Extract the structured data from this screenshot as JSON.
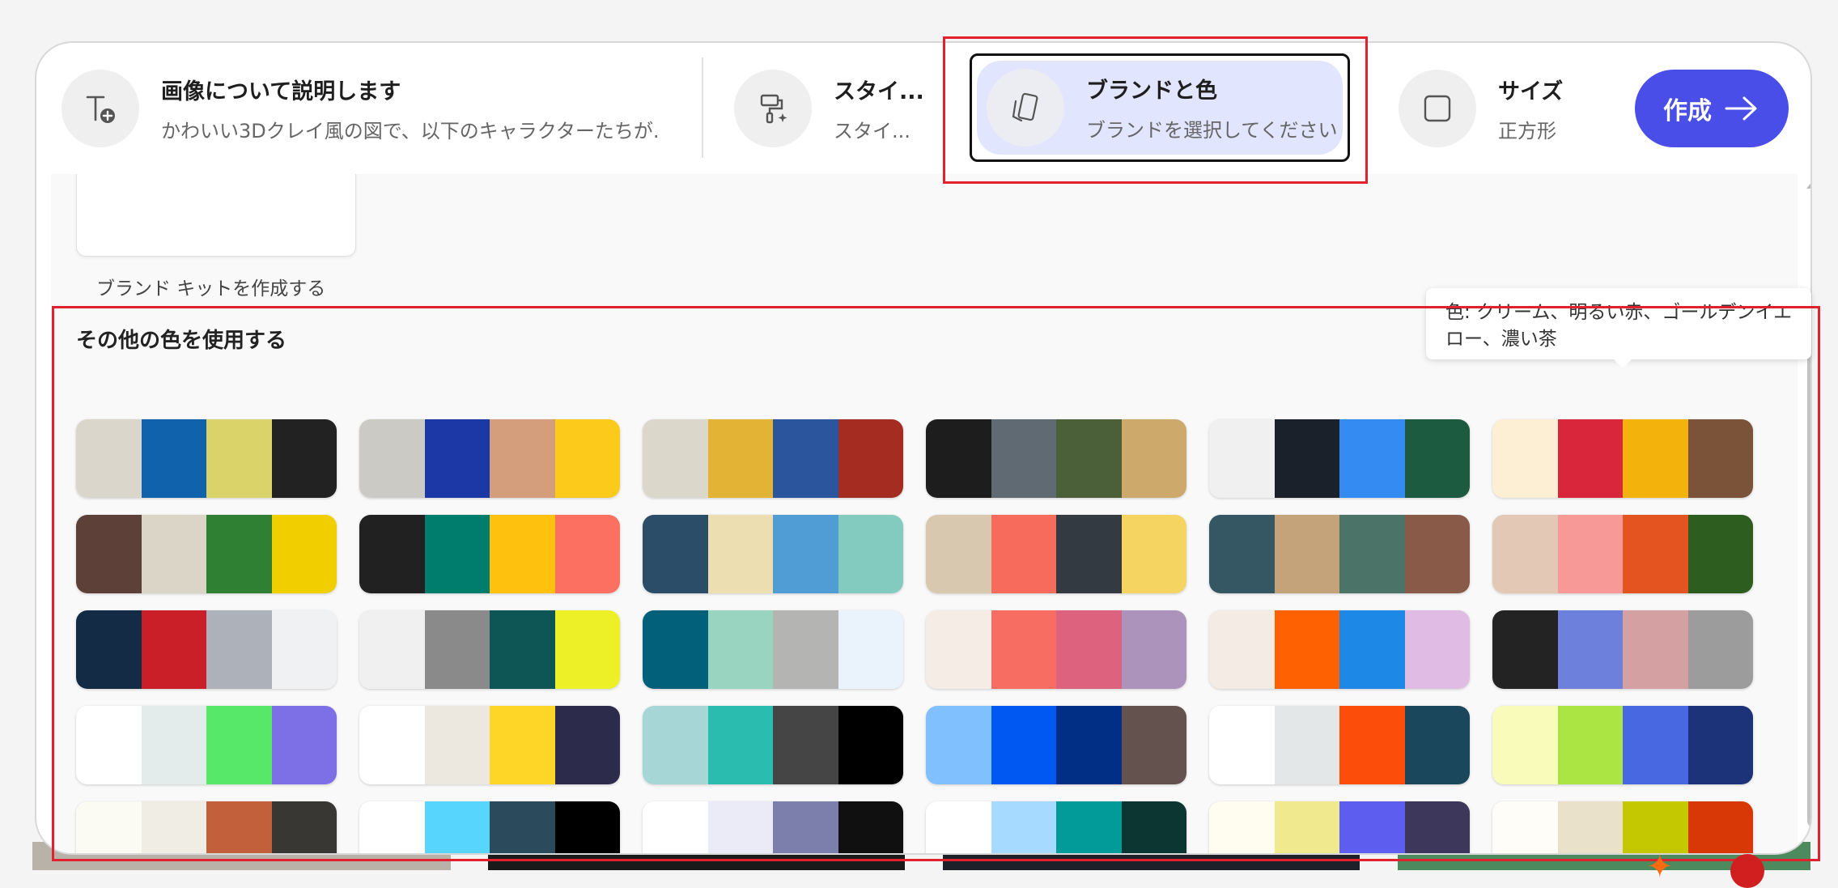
{
  "toolbar": {
    "describe": {
      "title": "画像について説明します",
      "subtitle": "かわいい3Dクレイ風の図で、以下のキャラクターたちが..."
    },
    "style": {
      "title": "スタイ...",
      "subtitle": "スタイ..."
    },
    "brand": {
      "title": "ブランドと色",
      "subtitle": "ブランドを選択してください"
    },
    "size": {
      "title": "サイズ",
      "subtitle": "正方形"
    },
    "create_label": "作成"
  },
  "brand_kit": {
    "create_label": "ブランド キットを作成する"
  },
  "other_colors": {
    "title": "その他の色を使用する"
  },
  "tooltip": {
    "text": "色: クリーム、明るい赤、ゴールデンイエロー、濃い茶"
  },
  "palettes": [
    [
      "#dbd6cb",
      "#0f62ab",
      "#dad36a",
      "#222222"
    ],
    [
      "#cbcac5",
      "#1c37a6",
      "#d49d7c",
      "#fcca1a"
    ],
    [
      "#dbd7cb",
      "#e2b334",
      "#2b569e",
      "#a52c20"
    ],
    [
      "#1d1d1d",
      "#606a72",
      "#4b5f39",
      "#cda96c"
    ],
    [
      "#f0f0f0",
      "#1a212b",
      "#348cf2",
      "#1c5b3f"
    ],
    [
      "#fdefd4",
      "#d9263a",
      "#f3b20c",
      "#7b5339"
    ],
    [
      "#5d4038",
      "#dbd5c8",
      "#2f8033",
      "#f0ce00"
    ],
    [
      "#212121",
      "#007d6d",
      "#fec10e",
      "#fc7062"
    ],
    [
      "#2c4d68",
      "#ecdeb0",
      "#4f9dd4",
      "#83cbbe"
    ],
    [
      "#d9c8b0",
      "#f76b5d",
      "#343a41",
      "#f6d462"
    ],
    [
      "#345763",
      "#c4a27a",
      "#4b7368",
      "#8a5a48"
    ],
    [
      "#e2c8b5",
      "#f79996",
      "#e35420",
      "#2e5e1f"
    ],
    [
      "#142b45",
      "#ca1e28",
      "#adb1b9",
      "#f0f1f3"
    ],
    [
      "#f0f0f0",
      "#8a8a8a",
      "#0e5556",
      "#edf026"
    ],
    [
      "#02607a",
      "#98d4c0",
      "#b4b4b3",
      "#eaf3fb"
    ],
    [
      "#f4ece5",
      "#f86d62",
      "#dc627e",
      "#ab93bc"
    ],
    [
      "#f4ece4",
      "#fd6102",
      "#1e88e6",
      "#e0bce4"
    ],
    [
      "#232323",
      "#6c80dc",
      "#d4a0a2",
      "#9c9c9c"
    ],
    [
      "#ffffff",
      "#e3ecea",
      "#57e86a",
      "#7d6fe5"
    ],
    [
      "#ffffff",
      "#ece8e0",
      "#fed628",
      "#2d2b4c"
    ],
    [
      "#a6d6d5",
      "#2abdaf",
      "#454545",
      "#000000"
    ],
    [
      "#80c0fe",
      "#0058f3",
      "#012f86",
      "#64524e"
    ],
    [
      "#ffffff",
      "#e3e7e7",
      "#fd4d0b",
      "#1a475b"
    ],
    [
      "#f9fbbb",
      "#abe544",
      "#4768e1",
      "#1c3379"
    ],
    [
      "#fcfbf3",
      "#efede4",
      "#c1603b",
      "#383733"
    ],
    [
      "#ffffff",
      "#57d5fc",
      "#2b4a5c",
      "#000000"
    ],
    [
      "#ffffff",
      "#ebebf7",
      "#7c7fab",
      "#101010"
    ],
    [
      "#ffffff",
      "#a7daff",
      "#039a9a",
      "#0b3632"
    ],
    [
      "#fefdf0",
      "#f0e98d",
      "#5d5ef0",
      "#3d375b"
    ],
    [
      "#fefdf8",
      "#eae1cb",
      "#c3c801",
      "#d83805"
    ]
  ]
}
